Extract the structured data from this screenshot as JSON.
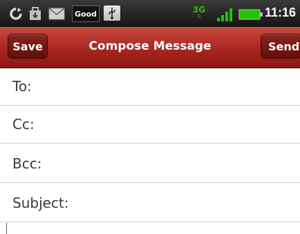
{
  "status_bar": {
    "time": "11:16",
    "good_label": "Good",
    "network_type": "3G",
    "network_arrows": "⇅",
    "icons": [
      "sync-icon",
      "download-icon",
      "mail-icon",
      "good-app-icon",
      "usb-icon",
      "network-3g-icon",
      "signal-icon",
      "battery-icon"
    ],
    "colors": {
      "network": "#21c600",
      "battery": "#21c600"
    }
  },
  "title_bar": {
    "title": "Compose Message",
    "save_label": "Save",
    "send_label": "Send",
    "colors": {
      "bar": "#a8261f",
      "button": "#7a1c16"
    }
  },
  "fields": {
    "to_label": "To:",
    "cc_label": "Cc:",
    "bcc_label": "Bcc:",
    "subject_label": "Subject:"
  }
}
